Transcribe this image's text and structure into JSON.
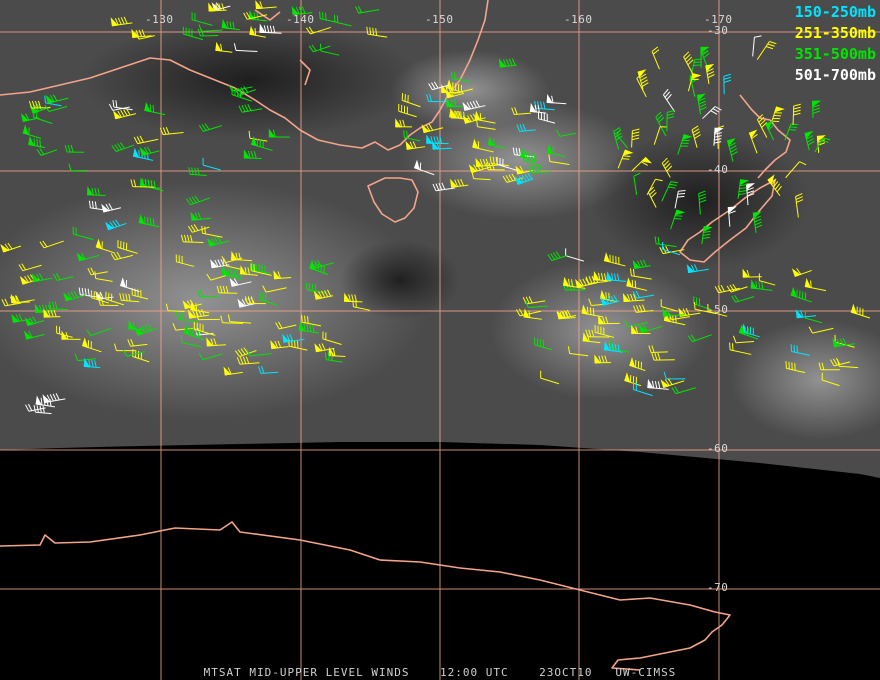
{
  "map": {
    "product_label": "MTSAT MID-UPPER LEVEL WINDS",
    "time_label": "12:00 UTC",
    "date_label": "23OCT10",
    "credit_label": "UW-CIMSS",
    "longitude_labels": [
      "-130",
      "-140",
      "-150",
      "-160",
      "-170"
    ],
    "latitude_labels": [
      "-30",
      "-40",
      "-50",
      "-60",
      "-70"
    ],
    "legend": [
      {
        "label": "150-250mb",
        "color": "#00e5ff"
      },
      {
        "label": "251-350mb",
        "color": "#ffff00"
      },
      {
        "label": "351-500mb",
        "color": "#00e600"
      },
      {
        "label": "501-700mb",
        "color": "#ffffff"
      }
    ],
    "colors": {
      "coastline": "#f3a48a",
      "gridlines": "#f3a48a",
      "no_data": "#000000",
      "satellite_background": "#4a4a4a"
    }
  }
}
